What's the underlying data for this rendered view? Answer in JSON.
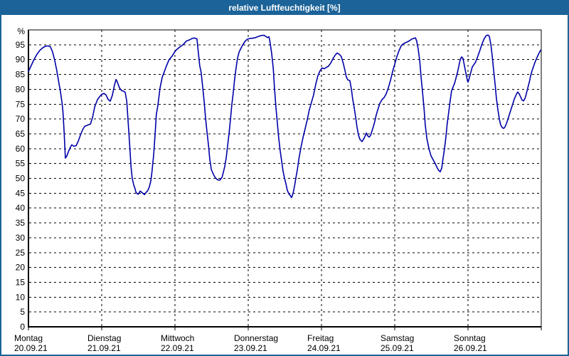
{
  "window": {
    "title": "relative Luftfeuchtigkeit [%]"
  },
  "colors": {
    "accent_blue": "#1b6398",
    "line_navy": "#0000a8",
    "grid": "#000000",
    "background": "#ffffff",
    "text": "#000000"
  },
  "chart_data": {
    "type": "line",
    "title": "relative Luftfeuchtigkeit [%]",
    "ylabel": "%",
    "ylim": [
      0,
      100
    ],
    "ytick_step": 5,
    "ytick_labels": [
      "0",
      "5",
      "10",
      "15",
      "20",
      "25",
      "30",
      "35",
      "40",
      "45",
      "50",
      "55",
      "60",
      "65",
      "70",
      "75",
      "80",
      "85",
      "90",
      "95"
    ],
    "x_range_hours": [
      0,
      168
    ],
    "grid_style": "dashed",
    "legend": "none",
    "x_days": [
      {
        "name": "Montag",
        "date": "20.09.21"
      },
      {
        "name": "Dienstag",
        "date": "21.09.21"
      },
      {
        "name": "Mittwoch",
        "date": "22.09.21"
      },
      {
        "name": "Donnerstag",
        "date": "23.09.21"
      },
      {
        "name": "Freitag",
        "date": "24.09.21"
      },
      {
        "name": "Samstag",
        "date": "25.09.21"
      },
      {
        "name": "Sonntag",
        "date": "26.09.21"
      }
    ],
    "series": [
      {
        "name": "relative Luftfeuchtigkeit",
        "unit": "%",
        "points_hour_value": [
          [
            0,
            86
          ],
          [
            0.9,
            88
          ],
          [
            1.9,
            90.2
          ],
          [
            2.8,
            91.8
          ],
          [
            3.7,
            93.1
          ],
          [
            4.7,
            94
          ],
          [
            5.6,
            94.5
          ],
          [
            6.5,
            94.6
          ],
          [
            7.2,
            94.3
          ],
          [
            7.9,
            92.6
          ],
          [
            8.6,
            89.8
          ],
          [
            9.3,
            86.2
          ],
          [
            10,
            82
          ],
          [
            10.5,
            79
          ],
          [
            11,
            75.5
          ],
          [
            11.3,
            72.5
          ],
          [
            11.7,
            65.5
          ],
          [
            12.1,
            56.8
          ],
          [
            12.6,
            57.6
          ],
          [
            13.1,
            59
          ],
          [
            13.8,
            60.6
          ],
          [
            14.2,
            61.3
          ],
          [
            14.9,
            60.8
          ],
          [
            15.6,
            61
          ],
          [
            16.3,
            62.5
          ],
          [
            17,
            64.5
          ],
          [
            17.7,
            66.3
          ],
          [
            18.4,
            67.5
          ],
          [
            19.3,
            67.9
          ],
          [
            20.3,
            68.3
          ],
          [
            21,
            70.5
          ],
          [
            21.7,
            74
          ],
          [
            22.6,
            76.5
          ],
          [
            23.3,
            77.5
          ],
          [
            24,
            78.3
          ],
          [
            24.7,
            78.6
          ],
          [
            25.4,
            78.1
          ],
          [
            26.1,
            76.6
          ],
          [
            26.8,
            76
          ],
          [
            27.5,
            78
          ],
          [
            28.2,
            81.5
          ],
          [
            28.7,
            83.3
          ],
          [
            29.1,
            82.5
          ],
          [
            29.8,
            80.5
          ],
          [
            30.5,
            79.6
          ],
          [
            31.2,
            79.3
          ],
          [
            31.7,
            79
          ],
          [
            32.2,
            76
          ],
          [
            32.6,
            70
          ],
          [
            33.1,
            62
          ],
          [
            33.6,
            54
          ],
          [
            34,
            50
          ],
          [
            34.5,
            47.7
          ],
          [
            34.9,
            46.6
          ],
          [
            35.2,
            45.3
          ],
          [
            35.9,
            44.6
          ],
          [
            36.6,
            45.7
          ],
          [
            37.3,
            45.1
          ],
          [
            38,
            44.5
          ],
          [
            38.4,
            45.1
          ],
          [
            39.1,
            45.9
          ],
          [
            39.6,
            47.1
          ],
          [
            40.1,
            49.2
          ],
          [
            40.5,
            52.5
          ],
          [
            41,
            57.8
          ],
          [
            41.5,
            65
          ],
          [
            41.9,
            71.5
          ],
          [
            42.4,
            74.6
          ],
          [
            43.1,
            80.4
          ],
          [
            43.8,
            84
          ],
          [
            44.5,
            85.9
          ],
          [
            45.2,
            87.9
          ],
          [
            46.1,
            90
          ],
          [
            47.1,
            91.2
          ],
          [
            47.8,
            92.4
          ],
          [
            48.5,
            93.3
          ],
          [
            49.4,
            94.1
          ],
          [
            50.6,
            95
          ],
          [
            51.7,
            96.2
          ],
          [
            52.9,
            96.7
          ],
          [
            53.6,
            97.1
          ],
          [
            54.3,
            97.3
          ],
          [
            55.2,
            97
          ],
          [
            55.6,
            93
          ],
          [
            56.1,
            88
          ],
          [
            56.6,
            85.5
          ],
          [
            57.1,
            80.5
          ],
          [
            57.6,
            75.5
          ],
          [
            58,
            70.5
          ],
          [
            58.5,
            65.5
          ],
          [
            59,
            61
          ],
          [
            59.4,
            56.5
          ],
          [
            59.9,
            53
          ],
          [
            60.6,
            51.3
          ],
          [
            61.3,
            50.1
          ],
          [
            62,
            49.5
          ],
          [
            62.7,
            49.4
          ],
          [
            63.4,
            50.3
          ],
          [
            63.8,
            51.8
          ],
          [
            64.3,
            54
          ],
          [
            64.8,
            57
          ],
          [
            65.2,
            60.5
          ],
          [
            65.7,
            65
          ],
          [
            66.2,
            70
          ],
          [
            66.6,
            74.5
          ],
          [
            67.1,
            79
          ],
          [
            67.5,
            83
          ],
          [
            68,
            87
          ],
          [
            68.5,
            90.5
          ],
          [
            69,
            92.5
          ],
          [
            69.7,
            94
          ],
          [
            70.4,
            95.3
          ],
          [
            71.1,
            96.3
          ],
          [
            71.8,
            96.9
          ],
          [
            72.5,
            97.1
          ],
          [
            73.4,
            97.2
          ],
          [
            74.4,
            97.4
          ],
          [
            75.3,
            97.8
          ],
          [
            76.2,
            98.1
          ],
          [
            77.1,
            98.2
          ],
          [
            77.8,
            97.8
          ],
          [
            78.3,
            97.4
          ],
          [
            78.8,
            97.7
          ],
          [
            79.2,
            95.5
          ],
          [
            79.7,
            92
          ],
          [
            80.2,
            87
          ],
          [
            80.6,
            80.5
          ],
          [
            81.1,
            73.5
          ],
          [
            81.6,
            68
          ],
          [
            82,
            63.5
          ],
          [
            82.5,
            59
          ],
          [
            83,
            55.5
          ],
          [
            83.4,
            52.5
          ],
          [
            83.9,
            50
          ],
          [
            84.4,
            48
          ],
          [
            84.8,
            46
          ],
          [
            85.3,
            44.8
          ],
          [
            85.8,
            44.2
          ],
          [
            86.2,
            43.5
          ],
          [
            86.7,
            45
          ],
          [
            87.2,
            47.5
          ],
          [
            87.6,
            50
          ],
          [
            88.1,
            53
          ],
          [
            88.6,
            56.5
          ],
          [
            89.2,
            60
          ],
          [
            89.9,
            63.5
          ],
          [
            90.6,
            66.5
          ],
          [
            91.3,
            69.5
          ],
          [
            92,
            73
          ],
          [
            92.7,
            75.5
          ],
          [
            93.4,
            78
          ],
          [
            94.1,
            81.5
          ],
          [
            94.8,
            84.5
          ],
          [
            95.5,
            86.2
          ],
          [
            96.2,
            87.2
          ],
          [
            96.9,
            86.9
          ],
          [
            97.6,
            87.4
          ],
          [
            98.3,
            87.8
          ],
          [
            99,
            88.8
          ],
          [
            99.7,
            90.2
          ],
          [
            100.4,
            91.4
          ],
          [
            101.1,
            92.2
          ],
          [
            101.8,
            91.8
          ],
          [
            102.5,
            91
          ],
          [
            103.2,
            88.5
          ],
          [
            103.7,
            86.3
          ],
          [
            104.1,
            84.3
          ],
          [
            104.6,
            83.2
          ],
          [
            105.3,
            82.9
          ],
          [
            105.8,
            80
          ],
          [
            106.2,
            76.8
          ],
          [
            106.7,
            73.9
          ],
          [
            107.2,
            70.5
          ],
          [
            107.6,
            67.5
          ],
          [
            108.1,
            64.7
          ],
          [
            108.6,
            63.1
          ],
          [
            109.3,
            62.4
          ],
          [
            110,
            63.6
          ],
          [
            110.7,
            65.3
          ],
          [
            111.1,
            64.4
          ],
          [
            111.6,
            63.9
          ],
          [
            112.1,
            64.5
          ],
          [
            112.5,
            65.8
          ],
          [
            113,
            67.5
          ],
          [
            113.5,
            69.3
          ],
          [
            113.9,
            71.2
          ],
          [
            114.4,
            73
          ],
          [
            115.1,
            75.2
          ],
          [
            115.8,
            76.5
          ],
          [
            116.5,
            77.2
          ],
          [
            117.2,
            78.5
          ],
          [
            117.9,
            80.5
          ],
          [
            118.6,
            83
          ],
          [
            119.3,
            86
          ],
          [
            120,
            88.5
          ],
          [
            120.7,
            91
          ],
          [
            121.4,
            93
          ],
          [
            122.1,
            94.6
          ],
          [
            122.8,
            95.3
          ],
          [
            123.5,
            95.7
          ],
          [
            124.2,
            96
          ],
          [
            124.9,
            96.4
          ],
          [
            125.6,
            96.9
          ],
          [
            126.3,
            97.2
          ],
          [
            126.8,
            97.3
          ],
          [
            127.2,
            96.2
          ],
          [
            127.7,
            93.5
          ],
          [
            128.2,
            89.5
          ],
          [
            128.6,
            84.5
          ],
          [
            129.1,
            79
          ],
          [
            129.6,
            73.5
          ],
          [
            130,
            68
          ],
          [
            130.5,
            63.5
          ],
          [
            131.2,
            60
          ],
          [
            131.9,
            57.5
          ],
          [
            132.6,
            56.2
          ],
          [
            133.3,
            54.9
          ],
          [
            133.8,
            53.8
          ],
          [
            134.3,
            52.8
          ],
          [
            134.9,
            52.2
          ],
          [
            135.4,
            53.5
          ],
          [
            135.8,
            56.5
          ],
          [
            136.3,
            60
          ],
          [
            136.8,
            64.3
          ],
          [
            137.2,
            68.5
          ],
          [
            137.7,
            72.5
          ],
          [
            138.2,
            76.5
          ],
          [
            138.6,
            79.3
          ],
          [
            139.1,
            80.8
          ],
          [
            139.6,
            82
          ],
          [
            140,
            83.5
          ],
          [
            140.5,
            85.5
          ],
          [
            141,
            87.8
          ],
          [
            141.4,
            89.8
          ],
          [
            141.9,
            90.9
          ],
          [
            142.4,
            90.3
          ],
          [
            142.8,
            88
          ],
          [
            143.3,
            85.5
          ],
          [
            143.8,
            83
          ],
          [
            144,
            82.4
          ],
          [
            144.5,
            84
          ],
          [
            145,
            86
          ],
          [
            145.4,
            87.5
          ],
          [
            145.9,
            88.3
          ],
          [
            146.4,
            89
          ],
          [
            147.1,
            90.8
          ],
          [
            147.8,
            92.8
          ],
          [
            148.5,
            95
          ],
          [
            149.2,
            96.8
          ],
          [
            149.9,
            98
          ],
          [
            150.5,
            98.3
          ],
          [
            151,
            97.8
          ],
          [
            151.5,
            95
          ],
          [
            151.9,
            91.5
          ],
          [
            152.4,
            86.5
          ],
          [
            152.9,
            81.5
          ],
          [
            153.3,
            77
          ],
          [
            153.8,
            73
          ],
          [
            154.3,
            69.8
          ],
          [
            154.7,
            68
          ],
          [
            155.2,
            67.1
          ],
          [
            155.7,
            66.8
          ],
          [
            156.1,
            67.3
          ],
          [
            156.6,
            68.5
          ],
          [
            157.1,
            70
          ],
          [
            157.8,
            72.3
          ],
          [
            158.5,
            74.5
          ],
          [
            159.2,
            76.8
          ],
          [
            159.9,
            78.4
          ],
          [
            160.3,
            79.1
          ],
          [
            160.8,
            78.4
          ],
          [
            161.3,
            77.3
          ],
          [
            161.7,
            76.4
          ],
          [
            162.2,
            76.1
          ],
          [
            162.7,
            77
          ],
          [
            163.1,
            78.5
          ],
          [
            163.6,
            80.5
          ],
          [
            164.1,
            82.5
          ],
          [
            164.5,
            84.5
          ],
          [
            165,
            86.3
          ],
          [
            165.5,
            87.8
          ],
          [
            165.9,
            89
          ],
          [
            166.4,
            90.2
          ],
          [
            166.8,
            91.2
          ],
          [
            167.3,
            92.2
          ],
          [
            167.8,
            93.2
          ]
        ]
      }
    ]
  }
}
